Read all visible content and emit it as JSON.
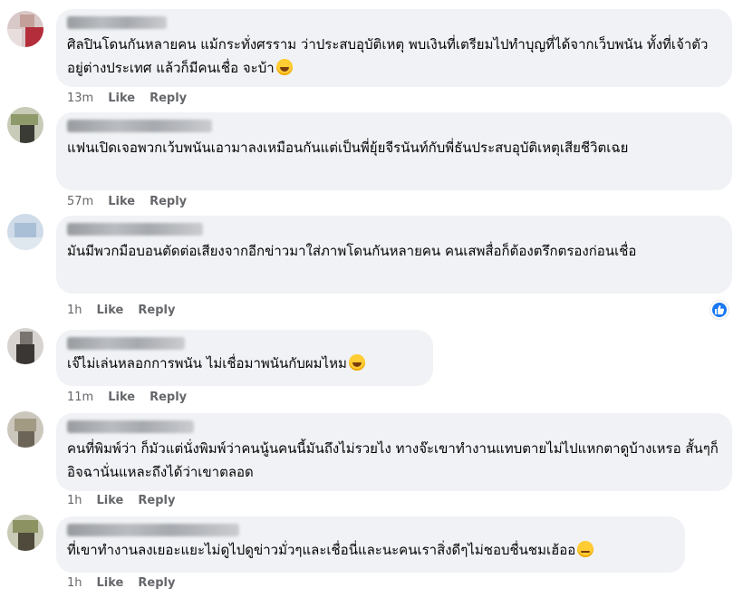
{
  "labels": {
    "like": "Like",
    "reply": "Reply"
  },
  "comments": [
    {
      "text": "ศิลปินโดนกันหลายคน แม้กระทั่งศรราม ว่าประสบอุบัติเหตุ พบเงินที่เตรียมไปทำบุญที่ได้จากเว็บพนัน ทั้งที่เจ้าตัวอยู่ต่างประเทศ แล้วก็มีคนเชื่อ จะบ้า",
      "emoji": "laughing-face",
      "time": "13m"
    },
    {
      "text": "แฟนเปิดเจอพวกเว้บพนันเอามาลงเหมือนกันแต่เป็นพี่ยุ้ยจีรนันท์กับพี่ธันประสบอุบัติเหตุเสียชีวิตเฉย",
      "time": "57m"
    },
    {
      "text": "มันมีพวกมือบอนตัดต่อเสียงจากอีกข่าวมาใส่ภาพโดนกันหลายคน คนเสพสื่อก็ต้องตรึกตรองก่อนเชื่อ",
      "time": "1h"
    },
    {
      "text": "เจ๊ไม่เล่นหลอกการพนัน ไม่เชื่อมาพนันกับผมไหม",
      "emoji": "grinning-face",
      "time": "11m"
    },
    {
      "text": "คนที่พิมพ์ว่า ก็มัวแต่นั่งพิมพ์ว่าคนนู้นคนนี้มันถึงไม่รวยไง ทางจ๊ะเขาทำงานแทบตายไม่ไปแหกตาดูบ้างเหรอ สั้นๆก็อิจฉานั่นแหละถึงได้ว่าเขาตลอด",
      "time": "1h"
    },
    {
      "text": "ที่เขาทำงานลงเยอะแยะไม่ดูไปดูข่าวมั่วๆและเชื่อนี่และนะคนเราสิ่งดีๆไม่ชอบชื่นชมเฮ้ออ",
      "emoji": "eye-roll-face",
      "time": "1h"
    }
  ],
  "reaction": {
    "icon": "like-reaction-icon",
    "color": "#1877f2"
  }
}
